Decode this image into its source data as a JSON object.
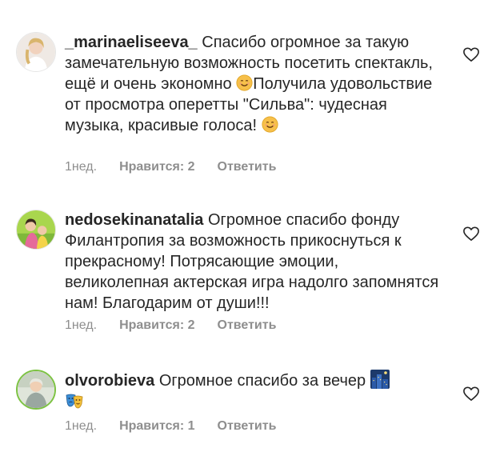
{
  "comments": [
    {
      "username": "_marinaeliseeva_",
      "text_1": " Спасибо огромное за такую замечательную возможность посетить спектакль, ещё и очень экономно ",
      "text_2": "Получила удовольствие от просмотра оперетты \"Сильва\": чудесная музыка, красивые голоса! ",
      "emoji_1": "smiling-face-emoji",
      "emoji_2": "smiling-face-emoji",
      "time": "1нед.",
      "likes": "Нравится: 2",
      "reply": "Ответить",
      "heart_icon": "heart-outline-icon"
    },
    {
      "username": "nedosekinanatalia",
      "text_1": " Огромное спасибо фонду Филантропия за возможность прикоснуться к прекрасному! Потрясающие эмоции, великолепная актерская игра надолго запомнятся нам! Благодарим от души!!!",
      "time": "1нед.",
      "likes": "Нравится: 2",
      "reply": "Ответить",
      "heart_icon": "heart-outline-icon"
    },
    {
      "username": "olvorobieva",
      "text_1": " Огромное спасибо за вечер ",
      "emoji_1": "night-city-emoji",
      "emoji_2": "performing-arts-emoji",
      "time": "1нед.",
      "likes": "Нравится: 1",
      "reply": "Ответить",
      "heart_icon": "heart-outline-icon"
    }
  ],
  "colors": {
    "text": "#262626",
    "meta": "#8e8e8e",
    "emoji_face": "#f7c04a"
  }
}
